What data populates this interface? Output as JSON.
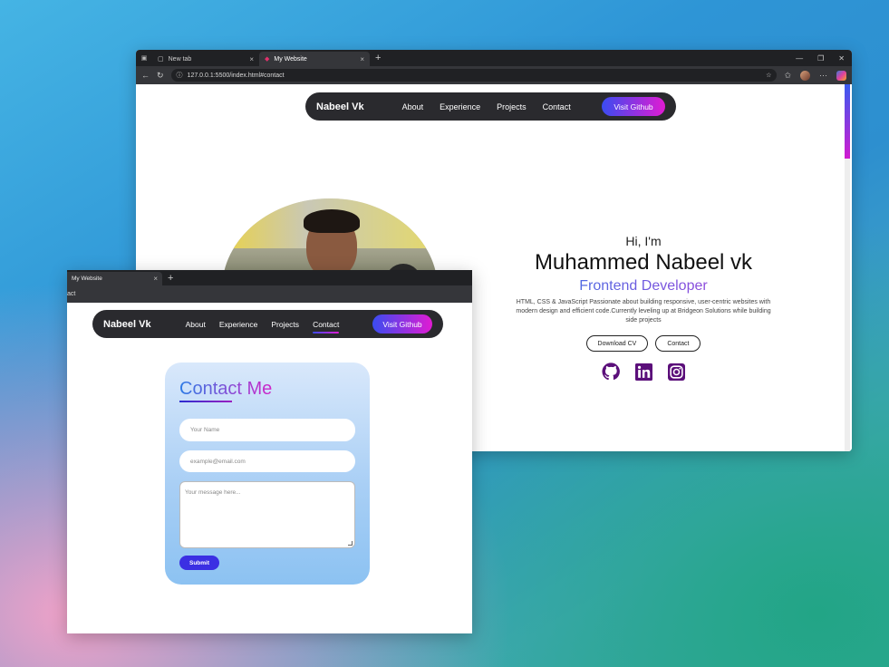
{
  "back_window": {
    "tabs": [
      {
        "label": "New tab",
        "close": "×"
      },
      {
        "label": "My Website",
        "close": "×"
      }
    ],
    "new_tab": "+",
    "url": "127.0.0.1:5500/index.html#contact",
    "nav": {
      "brand": "Nabeel Vk",
      "links": [
        "About",
        "Experience",
        "Projects",
        "Contact"
      ],
      "github": "Visit Github"
    },
    "hero": {
      "greeting": "Hi, I'm",
      "name": "Muhammed Nabeel vk",
      "role": "Frontend Developer",
      "description": "HTML, CSS & JavaScript Passionate about building responsive, user-centric websites with modern design and efficient code.Currently leveling up at Bridgeon Solutions while building side projects",
      "download_cv": "Download CV",
      "contact": "Contact",
      "socials": [
        "github-icon",
        "linkedin-icon",
        "instagram-icon"
      ],
      "social_color": "#5b0f7a"
    }
  },
  "front_window": {
    "tab": {
      "label": "My Website",
      "close": "×"
    },
    "new_tab": "+",
    "url_fragment": "act",
    "nav": {
      "brand": "Nabeel Vk",
      "links": [
        "About",
        "Experience",
        "Projects",
        "Contact"
      ],
      "active": "Contact",
      "github": "Visit Github"
    },
    "contact": {
      "title": "Contact Me",
      "name_placeholder": "Your Name",
      "email_placeholder": "example@email.com",
      "message_placeholder": "Your message here...",
      "submit": "Submit"
    }
  },
  "colors": {
    "accent_blue": "#3a4cf0",
    "accent_pink": "#e01bd2",
    "nav_bg": "#2a2a2e",
    "submit_bg": "#3b2fe3"
  }
}
